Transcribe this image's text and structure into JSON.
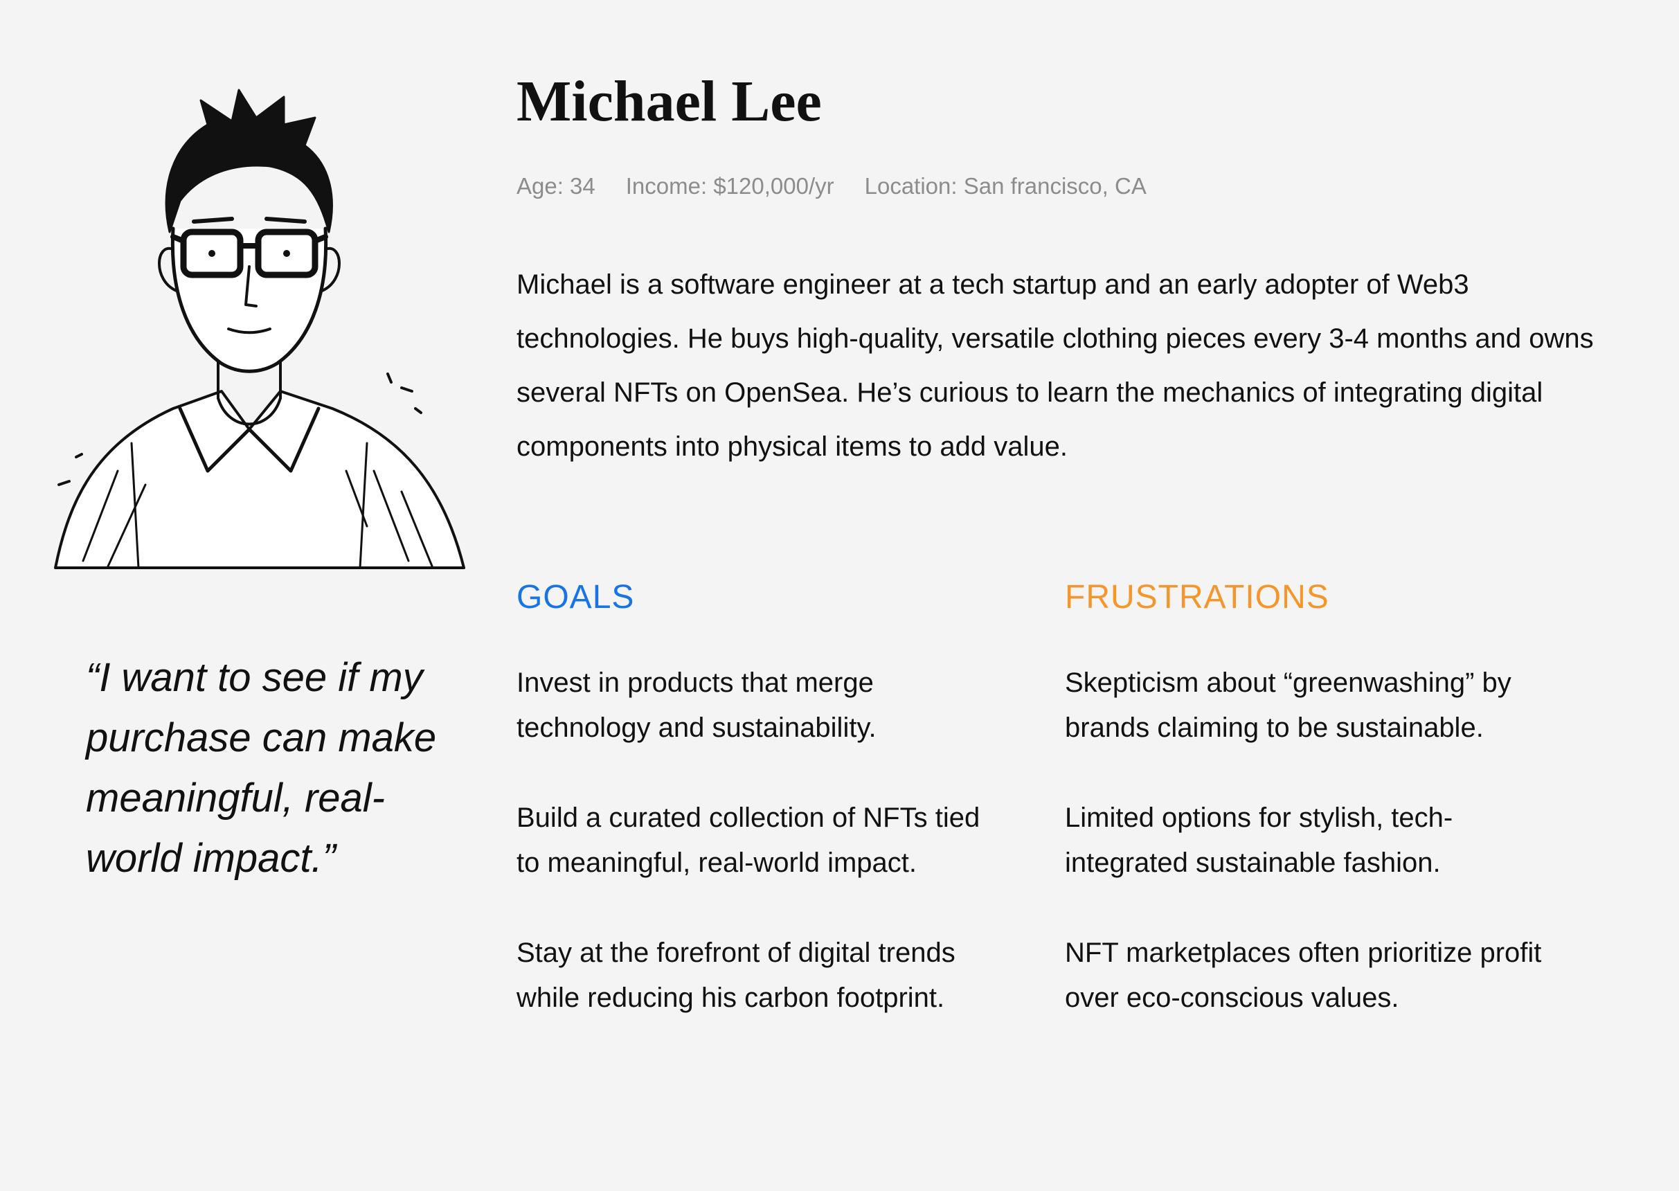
{
  "persona": {
    "name": "Michael Lee",
    "meta": [
      "Age: 34",
      "Income: $120,000/yr",
      "Location: San francisco, CA"
    ],
    "bio": "Michael is a software engineer at a tech startup and an early adopter of Web3 technologies. He buys high-quality, versatile clothing pieces every 3-4 months and owns several NFTs on OpenSea. He’s curious to learn the mechanics of integrating digital components into physical items to add value.",
    "quote": "“I want to see if my purchase can make meaningful, real-world impact.”"
  },
  "goals": {
    "heading": "GOALS",
    "items": [
      "Invest in products that merge technology and sustainability.",
      "Build a curated collection of NFTs tied to meaningful, real-world impact.",
      "Stay at the forefront of digital trends while reducing his carbon footprint."
    ]
  },
  "frustrations": {
    "heading": "FRUSTRATIONS",
    "items": [
      "Skepticism about “greenwashing” by brands claiming to be sustainable.",
      "Limited options for stylish, tech-integrated sustainable fashion.",
      "NFT marketplaces often prioritize profit over eco-conscious values."
    ]
  },
  "colors": {
    "background": "#f4f4f4",
    "goals_accent": "#1873e6",
    "frustrations_accent": "#f5962b",
    "meta_text": "#8c8c8c"
  }
}
